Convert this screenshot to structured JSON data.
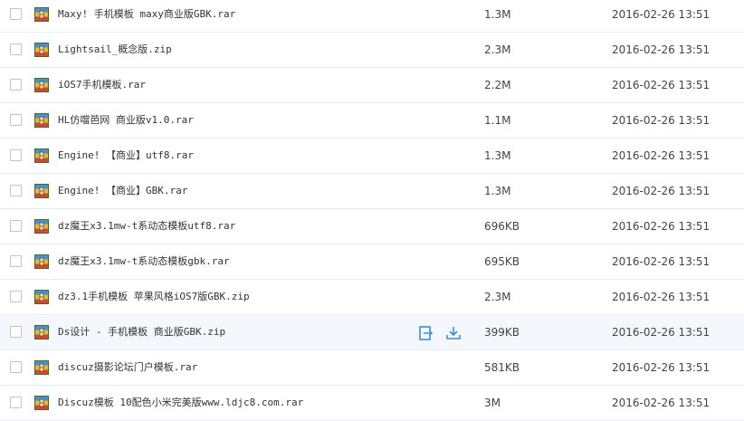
{
  "files": [
    {
      "name": "Maxy! 手机模板 maxy商业版GBK.rar",
      "size": "1.3M",
      "date": "2016-02-26 13:51"
    },
    {
      "name": "Lightsail_概念版.zip",
      "size": "2.3M",
      "date": "2016-02-26 13:51"
    },
    {
      "name": "iOS7手机模板.rar",
      "size": "2.2M",
      "date": "2016-02-26 13:51"
    },
    {
      "name": "HL仿噹芭网 商业版v1.0.rar",
      "size": "1.1M",
      "date": "2016-02-26 13:51"
    },
    {
      "name": "Engine! 【商业】utf8.rar",
      "size": "1.3M",
      "date": "2016-02-26 13:51"
    },
    {
      "name": "Engine! 【商业】GBK.rar",
      "size": "1.3M",
      "date": "2016-02-26 13:51"
    },
    {
      "name": "dz魔王x3.1mw-t系动态模板utf8.rar",
      "size": "696KB",
      "date": "2016-02-26 13:51"
    },
    {
      "name": "dz魔王x3.1mw-t系动态模板gbk.rar",
      "size": "695KB",
      "date": "2016-02-26 13:51"
    },
    {
      "name": "dz3.1手机模板 苹果风格iOS7版GBK.zip",
      "size": "2.3M",
      "date": "2016-02-26 13:51"
    },
    {
      "name": "Ds设计 - 手机模板 商业版GBK.zip",
      "size": "399KB",
      "date": "2016-02-26 13:51"
    },
    {
      "name": "discuz摄影论坛门户模板.rar",
      "size": "581KB",
      "date": "2016-02-26 13:51"
    },
    {
      "name": "Discuz模板 10配色小米完美版www.ldjc8.com.rar",
      "size": "3M",
      "date": "2016-02-26 13:51"
    }
  ],
  "hovered_row": 9,
  "row_actions": {
    "share_icon": "share-icon",
    "download_icon": "download-icon"
  },
  "colors": {
    "hover_bg": "#f4f8fc",
    "divider": "#e8edf2",
    "action_blue": "#3b8fd6"
  }
}
